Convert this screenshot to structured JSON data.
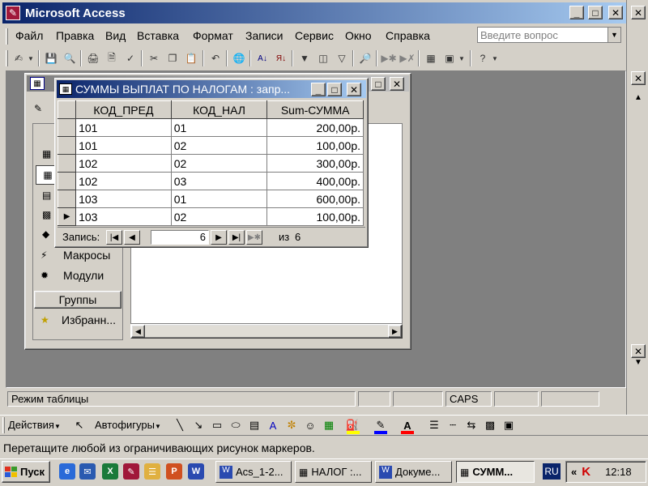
{
  "app": {
    "title": "Microsoft Access",
    "menu": [
      "Файл",
      "Правка",
      "Вид",
      "Вставка",
      "Формат",
      "Записи",
      "Сервис",
      "Окно",
      "Справка"
    ],
    "help_placeholder": "Введите вопрос"
  },
  "query_window": {
    "title": "СУММЫ ВЫПЛАТ ПО НАЛОГАМ : запр...",
    "columns": [
      "КОД_ПРЕД",
      "КОД_НАЛ",
      "Sum-СУММА"
    ],
    "rows": [
      [
        "101",
        "01",
        "200,00р."
      ],
      [
        "101",
        "02",
        "100,00р."
      ],
      [
        "102",
        "02",
        "300,00р."
      ],
      [
        "102",
        "03",
        "400,00р."
      ],
      [
        "103",
        "01",
        "600,00р."
      ],
      [
        "103",
        "02",
        "100,00р."
      ]
    ],
    "nav_label": "Запись:",
    "current_record": "6",
    "of_label": "из",
    "total_records": "6"
  },
  "db_window": {
    "items": [
      "Макросы",
      "Модули"
    ],
    "groups_label": "Группы",
    "favorites_label": "Избранн..."
  },
  "status": {
    "mode": "Режим таблицы",
    "caps": "CAPS"
  },
  "drawing_toolbar": {
    "actions_label": "Действия",
    "autoshapes_label": "Автофигуры",
    "colors": {
      "fill": "#ffff00",
      "line": "#0000ff",
      "font": "#ff0000"
    }
  },
  "hint": "Перетащите любой из ограничивающих рисунок маркеров.",
  "taskbar": {
    "start_label": "Пуск",
    "tasks": [
      "Acs_1-2...",
      "НАЛОГ :...",
      "Докуме...",
      "СУММ..."
    ],
    "lang": "RU",
    "clock": "12:18"
  },
  "colors": {
    "titlebar_active": "#0a246a",
    "titlebar_active_end": "#a6caf0",
    "desktop_mdi": "#808080"
  }
}
